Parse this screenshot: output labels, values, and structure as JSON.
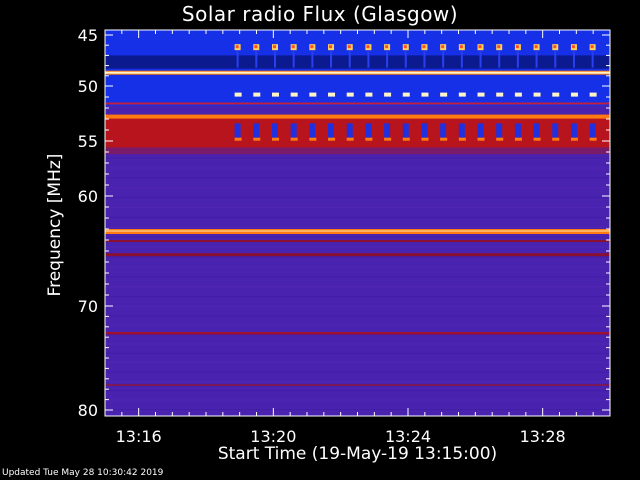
{
  "chart_data": {
    "type": "heatmap",
    "title": "Solar radio Flux (Glasgow)",
    "xlabel": "Start Time (19-May-19 13:15:00)",
    "ylabel": "Frequency [MHz]",
    "x_ticks": [
      "13:16",
      "13:20",
      "13:24",
      "13:28"
    ],
    "y_ticks": [
      "45",
      "50",
      "55",
      "60",
      "70",
      "80"
    ],
    "y_tick_values": [
      45,
      50,
      55,
      60,
      70,
      80
    ],
    "x_tick_minutes": [
      13.26667,
      13.33333,
      13.4,
      13.46667
    ],
    "ylim": [
      44.5,
      81
    ],
    "xrange_time": [
      "13:15:00",
      "13:30:00"
    ],
    "colors": {
      "background": "#4a22b0",
      "band_blue": "#1530e6",
      "band_red": "#b8141e",
      "band_orange": "#ff7a10",
      "band_white": "#fff4c8"
    }
  },
  "footer": "Updated Tue May 28 10:30:42 2019"
}
